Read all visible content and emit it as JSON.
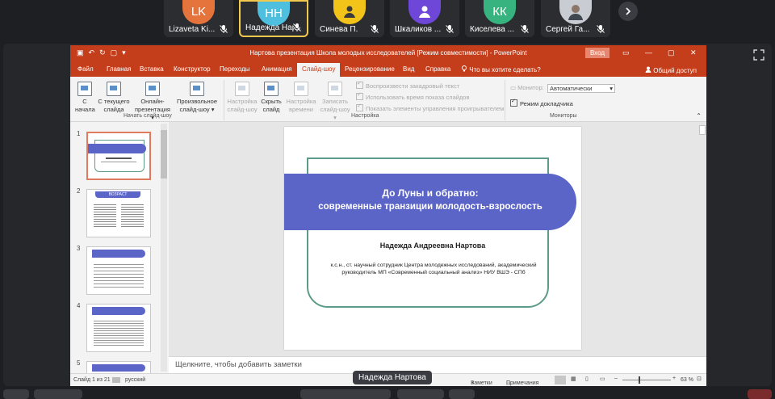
{
  "participants": [
    {
      "initials": "LK",
      "name": "Lizaveta Ki...",
      "color": "#e4733c",
      "left": 0
    },
    {
      "initials": "НН",
      "name": "Надежда Нар...",
      "color": "#4fbfe0",
      "active": true
    },
    {
      "initials": "",
      "name": "Синева П.",
      "color": "#f2c41a"
    },
    {
      "initials": "",
      "name": "Шкаликов ...",
      "color": "#6e47d9"
    },
    {
      "initials": "КК",
      "name": "Киселева ...",
      "color": "#36b37e"
    },
    {
      "initials": "",
      "name": "Сергей Га...",
      "color": "#c9ccd2"
    }
  ],
  "ppt": {
    "window_title": "Нартова презентация Школа молодых исследователей [Режим совместимости] - PowerPoint",
    "signin": "Вход",
    "tabs": [
      "Файл",
      "Главная",
      "Вставка",
      "Конструктор",
      "Переходы",
      "Анимация",
      "Слайд-шоу",
      "Рецензирование",
      "Вид",
      "Справка"
    ],
    "tell_me": "Что вы хотите сделать?",
    "share": "Общий доступ",
    "ribbon": {
      "from_start": [
        "С",
        "начала"
      ],
      "from_current": [
        "С текущего",
        "слайда"
      ],
      "online": [
        "Онлайн-",
        "презентация ▾"
      ],
      "custom": [
        "Произвольное",
        "слайд-шоу ▾"
      ],
      "group1": "Начать слайд-шоу",
      "setup": [
        "Настройка",
        "слайд-шоу"
      ],
      "hide": [
        "Скрыть",
        "слайд"
      ],
      "timing": [
        "Настройка",
        "времени"
      ],
      "record": [
        "Записать",
        "слайд-шоу ▾"
      ],
      "opt_narration": "Воспроизвести закадровый текст",
      "opt_timings": "Использовать время показа слайдов",
      "opt_controls": "Показать элементы управления проигрывателем",
      "group2": "Настройка",
      "monitor_label": "Монитор:",
      "monitor_value": "Автоматически",
      "presenter_view": "Режим докладчика",
      "group3": "Мониторы"
    },
    "thumbs": [
      "1",
      "2",
      "3",
      "4",
      "5"
    ],
    "thumb2_title": "ВОЗРАСТ",
    "slide": {
      "title_line1": "До Луны и обратно:",
      "title_line2": "современные транзиции молодость-взрослость",
      "author": "Надежда Андреевна Нартова",
      "affiliation": "к.с.н., ст. научный сотрудник Центра молодежных исследований, академический руководитель МП «Современный социальный анализ» НИУ ВШЭ - СПб"
    },
    "notes_placeholder": "Щелкните, чтобы добавить заметки",
    "status": {
      "slide": "Слайд 1 из 21",
      "lang": "русский",
      "notes": "Заметки",
      "comments": "Примечания",
      "zoom": "63 %"
    }
  },
  "speaker_label": "Надежда Нартова"
}
